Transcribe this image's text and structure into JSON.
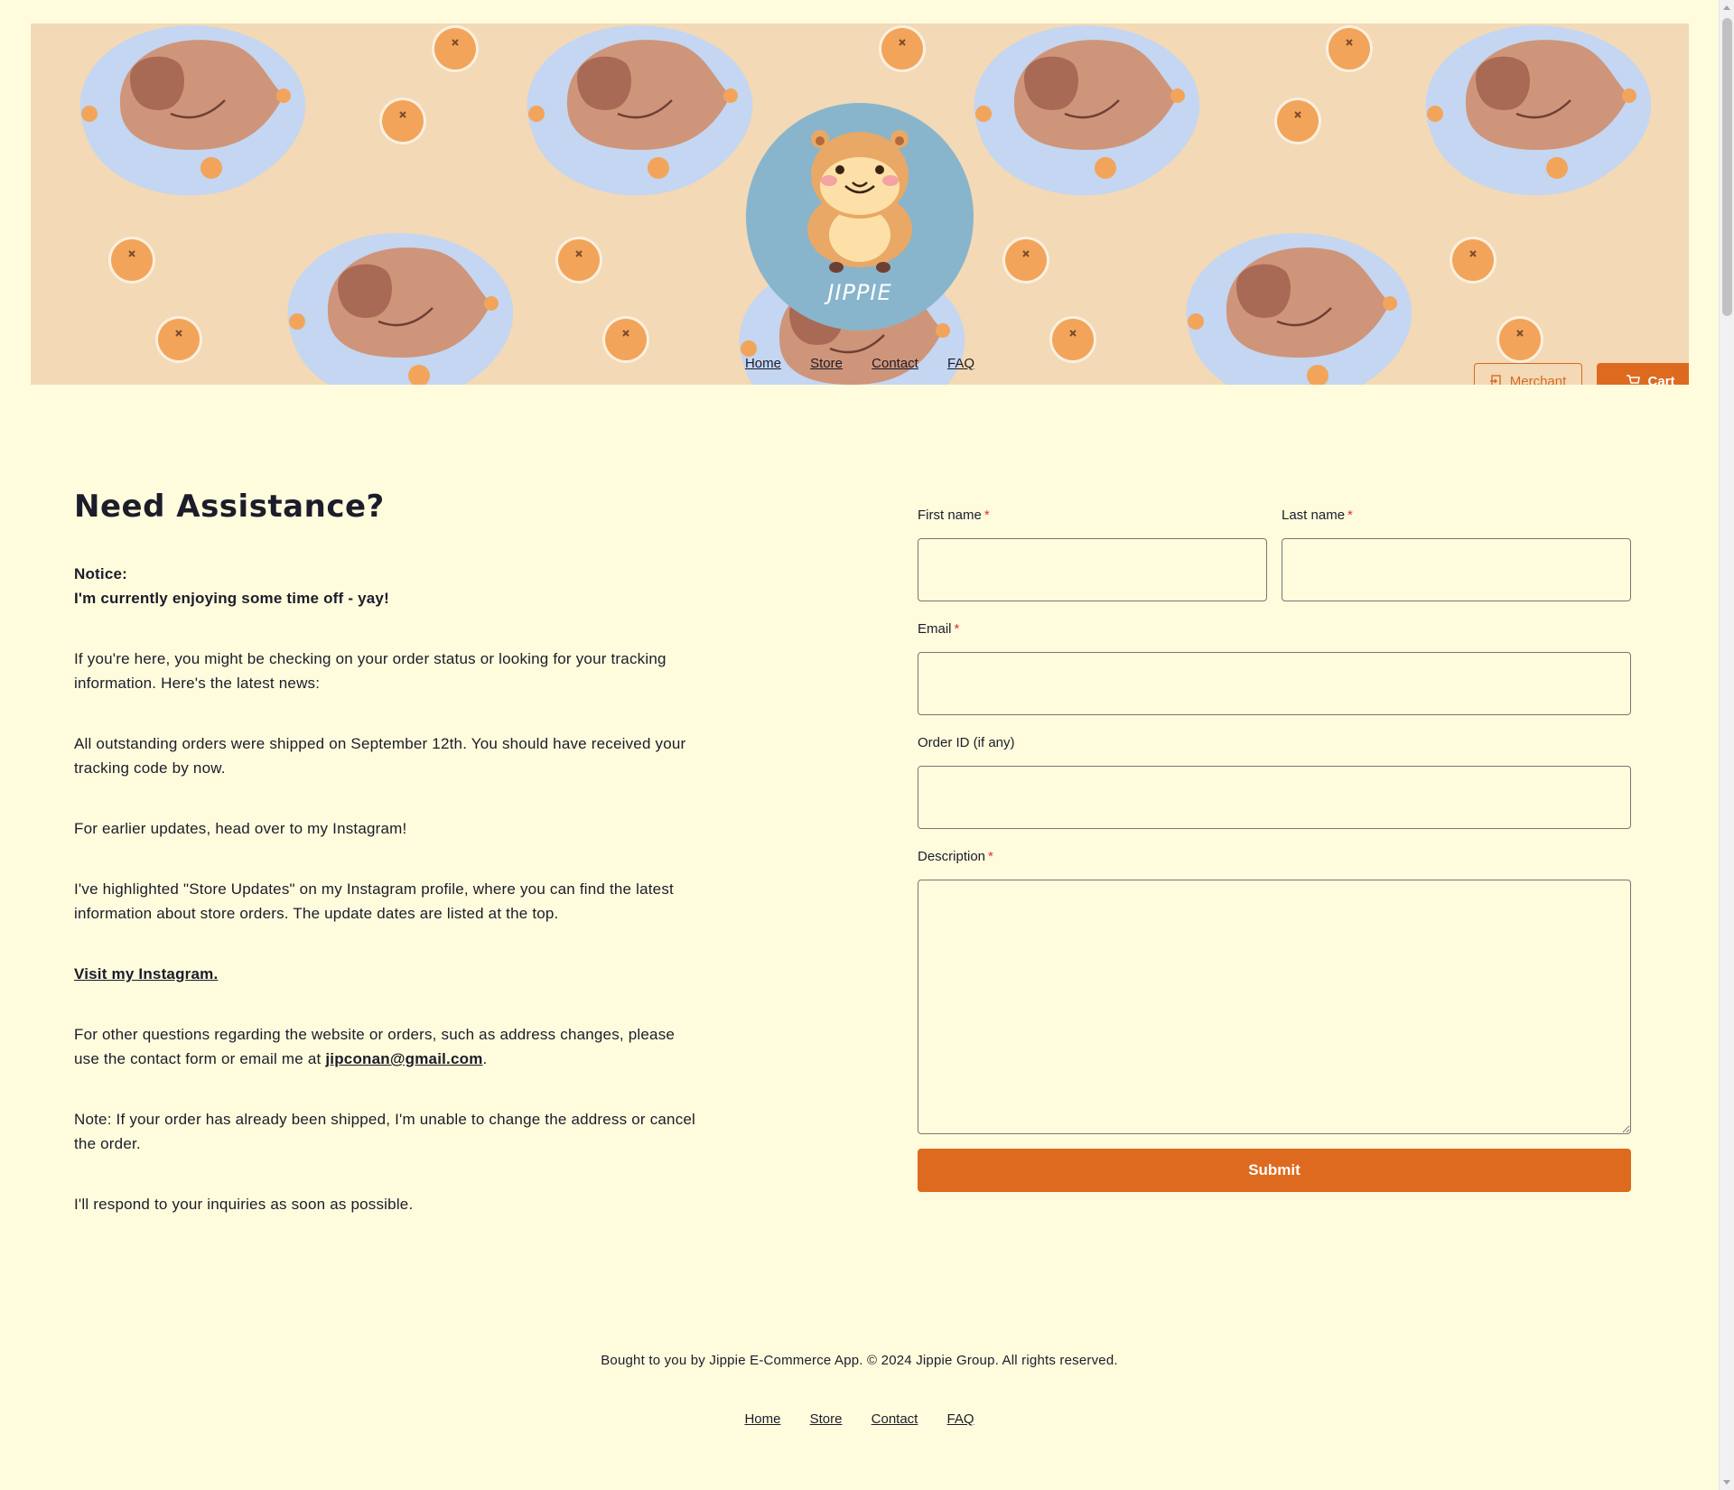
{
  "header": {
    "logo_text": "JIPPIE",
    "nav": [
      {
        "label": "Home"
      },
      {
        "label": "Store"
      },
      {
        "label": "Contact"
      },
      {
        "label": "FAQ"
      }
    ],
    "merchant_label": "Merchant",
    "cart_label": "Cart"
  },
  "main": {
    "title": "Need Assistance?",
    "notice_heading": "Notice:",
    "notice_text": "I'm currently enjoying some time off - yay!",
    "p1": "If you're here, you might be checking on your order status or looking for your tracking information. Here's the latest news:",
    "p2": "All outstanding orders were shipped on September 12th. You should have received your tracking code by now.",
    "p3": "For earlier updates, head over to my Instagram!",
    "p4": "I've highlighted \"Store Updates\" on my Instagram profile, where you can find the latest information about store orders. The update dates are listed at the top.",
    "instagram_link": "Visit my Instagram.",
    "p5_before": "For other questions regarding the website or orders, such as address changes, please use the contact form or email me at ",
    "email": "jipconan@gmail.com",
    "p5_after": ".",
    "p6": "Note: If your order has already been shipped, I'm unable to change the address or cancel the order.",
    "p7": "I'll respond to your inquiries as soon as possible."
  },
  "form": {
    "first_name_label": "First name",
    "last_name_label": "Last name",
    "email_label": "Email",
    "order_id_label": "Order ID (if any)",
    "description_label": "Description",
    "required_mark": "*",
    "submit_label": "Submit"
  },
  "footer": {
    "copyright": "Bought to you by Jippie E-Commerce App. © 2024 Jippie Group. All rights reserved.",
    "nav": [
      {
        "label": "Home"
      },
      {
        "label": "Store"
      },
      {
        "label": "Contact"
      },
      {
        "label": "FAQ"
      }
    ]
  },
  "colors": {
    "page_bg": "#fefcdd",
    "banner_bg": "#f3d9b5",
    "accent": "#dd6a1f",
    "logo_circle": "#88b5cc",
    "capybara": "#cf957a",
    "water": "#c4d6f1",
    "orange": "#f2a55a"
  },
  "icons": {
    "merchant": "login-icon",
    "cart": "cart-icon"
  }
}
